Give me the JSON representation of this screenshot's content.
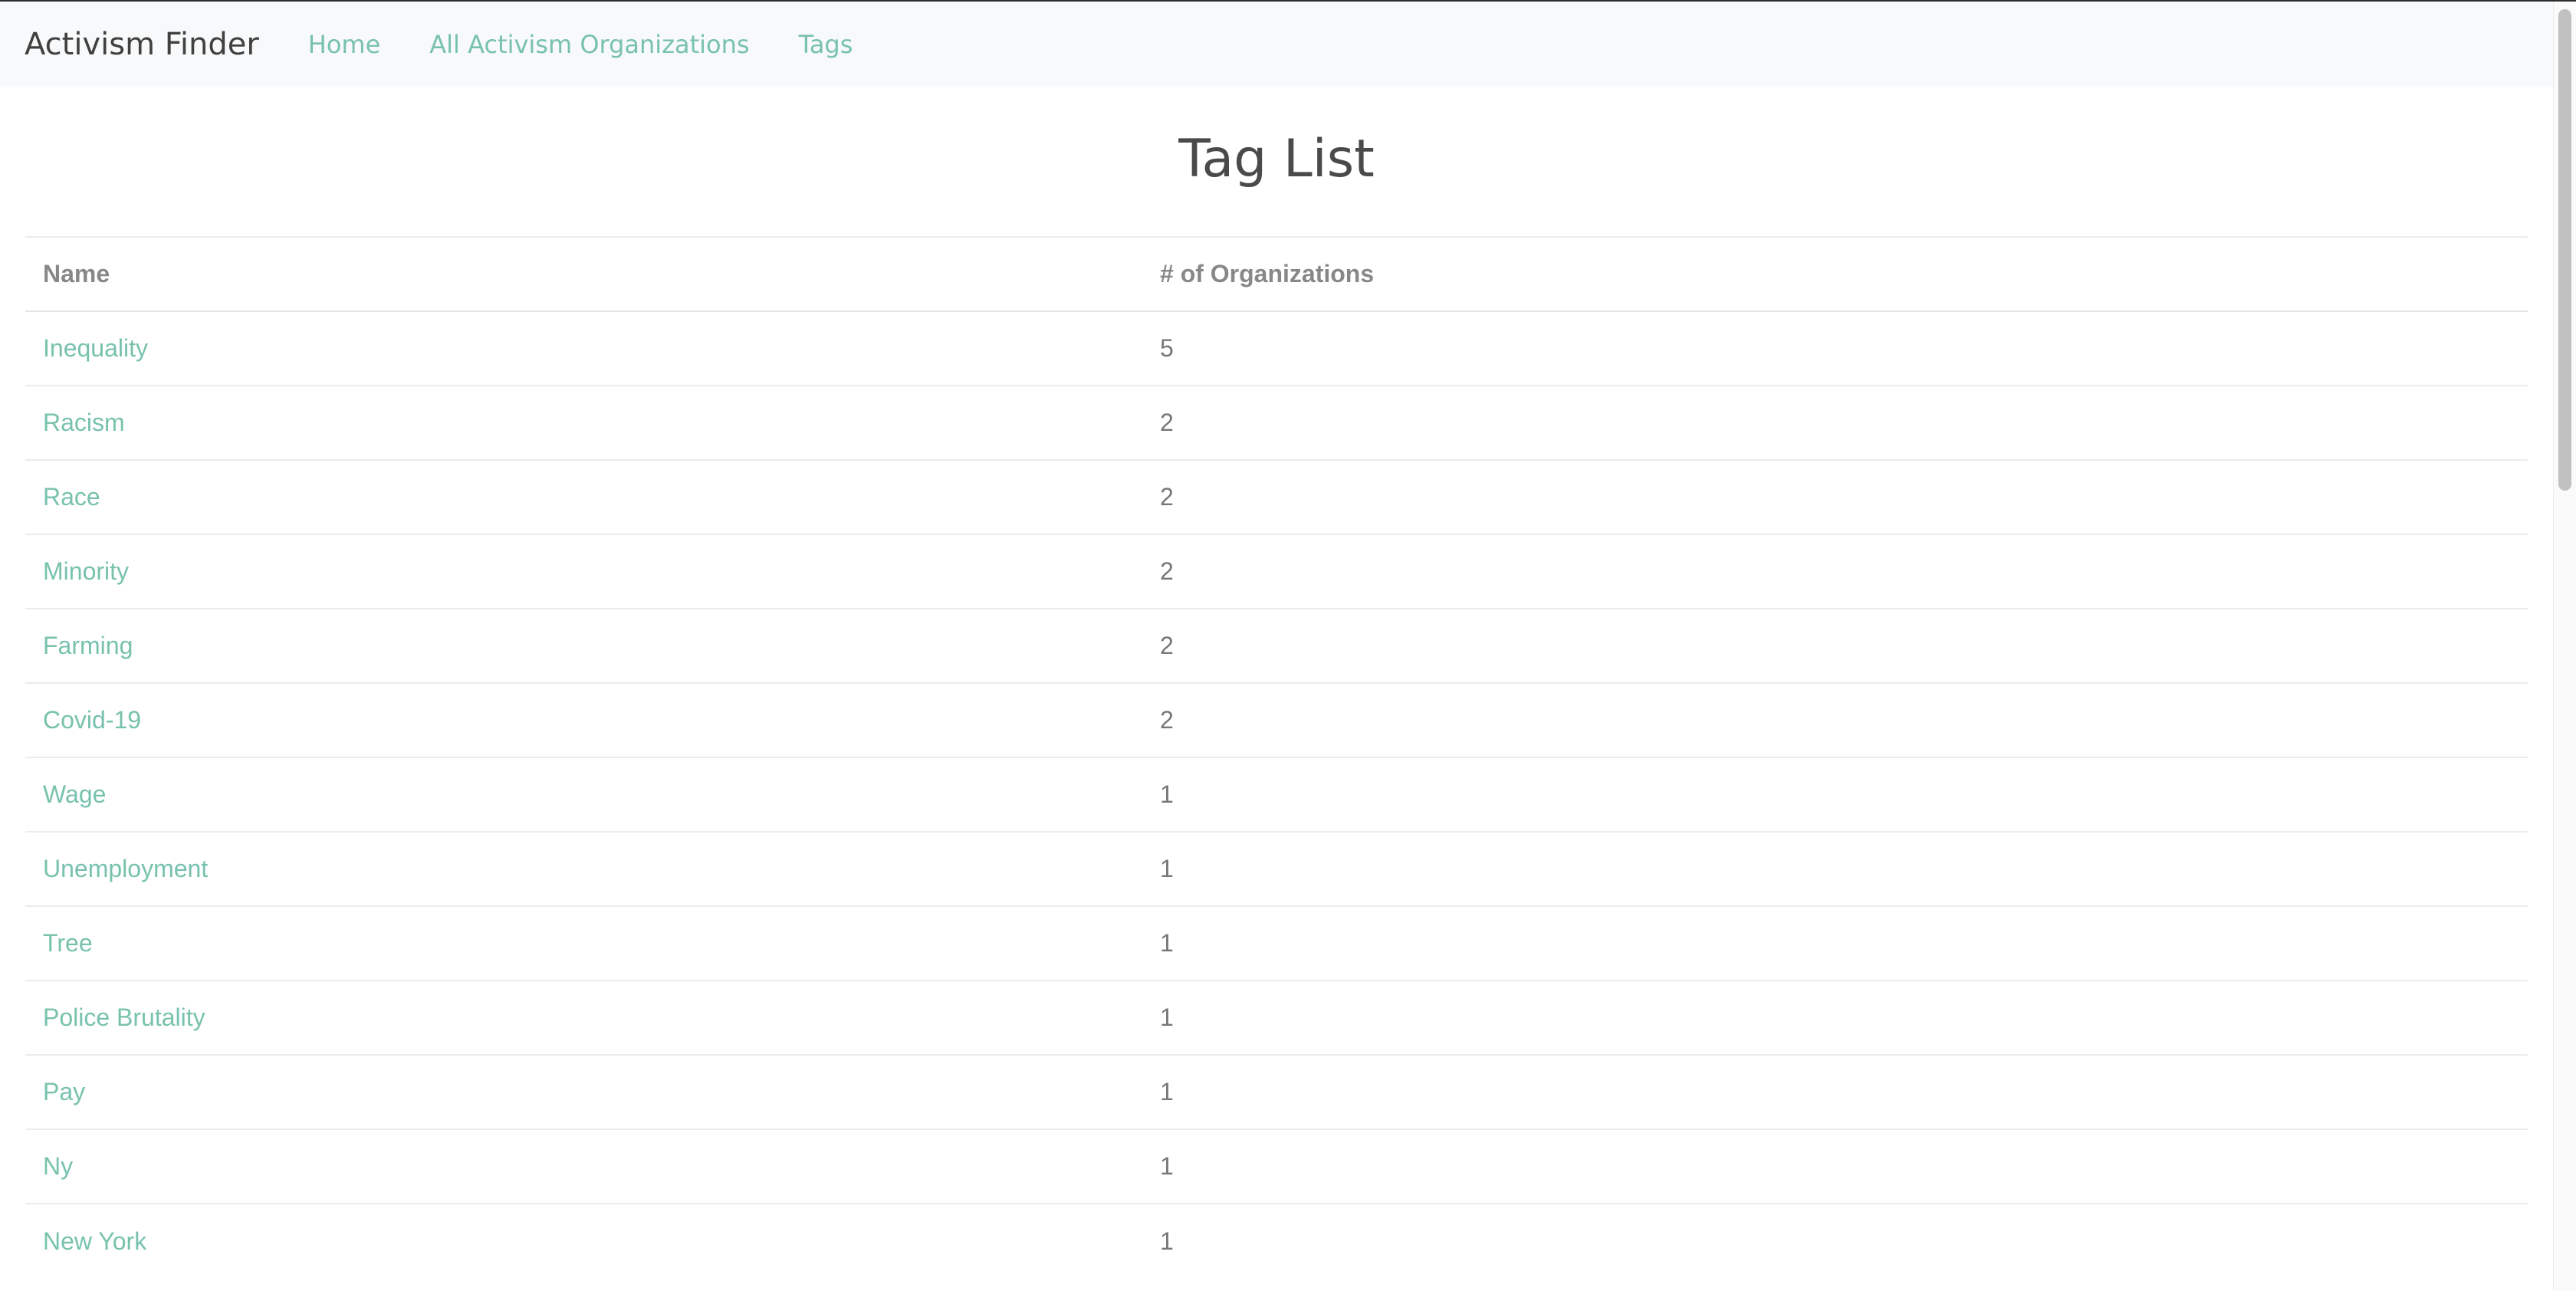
{
  "nav": {
    "brand": "Activism Finder",
    "links": [
      "Home",
      "All Activism Organizations",
      "Tags"
    ]
  },
  "page": {
    "title": "Tag List"
  },
  "table": {
    "headers": [
      "Name",
      "# of Organizations"
    ],
    "rows": [
      {
        "name": "Inequality",
        "count": "5"
      },
      {
        "name": "Racism",
        "count": "2"
      },
      {
        "name": "Race",
        "count": "2"
      },
      {
        "name": "Minority",
        "count": "2"
      },
      {
        "name": "Farming",
        "count": "2"
      },
      {
        "name": "Covid-19",
        "count": "2"
      },
      {
        "name": "Wage",
        "count": "1"
      },
      {
        "name": "Unemployment",
        "count": "1"
      },
      {
        "name": "Tree",
        "count": "1"
      },
      {
        "name": "Police Brutality",
        "count": "1"
      },
      {
        "name": "Pay",
        "count": "1"
      },
      {
        "name": "Ny",
        "count": "1"
      },
      {
        "name": "New York",
        "count": "1"
      }
    ]
  },
  "colors": {
    "accent": "#78c2ad",
    "navbar_bg": "#f8f9fa",
    "text": "#4a4a4a"
  }
}
